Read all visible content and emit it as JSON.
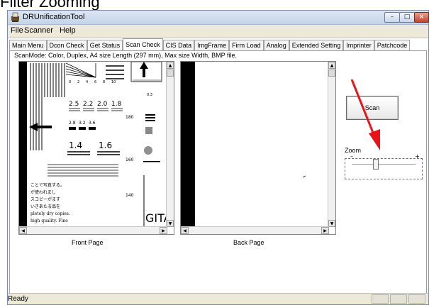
{
  "caption": "Filter Zooming",
  "window": {
    "title": "DRUnificationTool",
    "controls": {
      "minimize": "–",
      "maximize": "□",
      "close": "×"
    }
  },
  "menu": {
    "file": "File",
    "scanner": "Scanner",
    "help": "Help"
  },
  "tabs": [
    {
      "label": "Main Menu",
      "active": false
    },
    {
      "label": "Dcon Check",
      "active": false
    },
    {
      "label": "Get Status",
      "active": false
    },
    {
      "label": "Scan Check",
      "active": true
    },
    {
      "label": "CIS Data",
      "active": false
    },
    {
      "label": "ImgFrame",
      "active": false
    },
    {
      "label": "Firm Load",
      "active": false
    },
    {
      "label": "Analog",
      "active": false
    },
    {
      "label": "Extended Setting",
      "active": false
    },
    {
      "label": "Imprinter",
      "active": false
    },
    {
      "label": "Patchcode",
      "active": false
    }
  ],
  "scan_check": {
    "scan_mode": "ScanMode: Color, Duplex, A4 size Length (297 mm), Max size Width, BMP file.",
    "front_label": "Front Page",
    "back_label": "Back Page",
    "front_image": {
      "numbers": [
        "0",
        "2",
        "4",
        "6",
        "8",
        "10",
        "0.3",
        "2.5",
        "2.2",
        "2.0",
        "1.8",
        "2.8",
        "3.2",
        "3.6",
        "1.4",
        "1.6",
        "180",
        "160",
        "140"
      ],
      "text_lines": [
        "ことで写真する。",
        "が使われまし",
        "スコピーがます",
        "いきあたる品を",
        "pletely dry copies.",
        "high quality. Fine"
      ],
      "brand_fragment": "GITAL"
    },
    "scan_button": "Scan",
    "zoom": {
      "label": "Zoom",
      "min_symbol": "–",
      "max_symbol": "+",
      "level": 0.38
    }
  },
  "status": {
    "text": "Ready"
  },
  "colors": {
    "annotation_arrow": "#e8141a",
    "window_bg": "#ece9d8",
    "panel_bg": "#ffffff"
  },
  "icons": {
    "app": "scanner-app-icon",
    "annotation": "red-pointer-arrow"
  }
}
